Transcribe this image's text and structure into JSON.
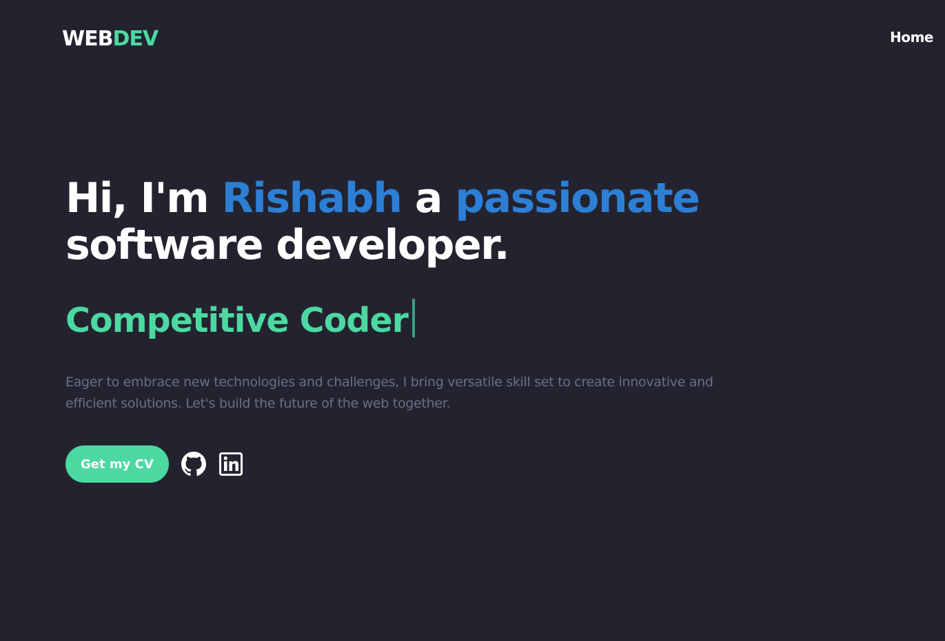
{
  "header": {
    "logo_part1": "WEB",
    "logo_part2": "DEV",
    "nav_home": "Home"
  },
  "hero": {
    "title_part1": "Hi, I'm ",
    "title_name": "Rishabh",
    "title_part2": " a ",
    "title_accent": "passionate",
    "title_part3": "software developer.",
    "role_text": "Competitive Coder",
    "description": "Eager to embrace new technologies and challenges, I bring versatile skill set to create innovative and efficient solutions. Let's build the future of the web together.",
    "cv_button_label": "Get my CV"
  },
  "icons": {
    "github": "github-icon",
    "linkedin": "linkedin-icon"
  },
  "colors": {
    "background": "#232330",
    "accent_green": "#4cd9a1",
    "accent_blue": "#2d7fd6",
    "text_white": "#ffffff",
    "text_muted": "#6b6f80"
  }
}
